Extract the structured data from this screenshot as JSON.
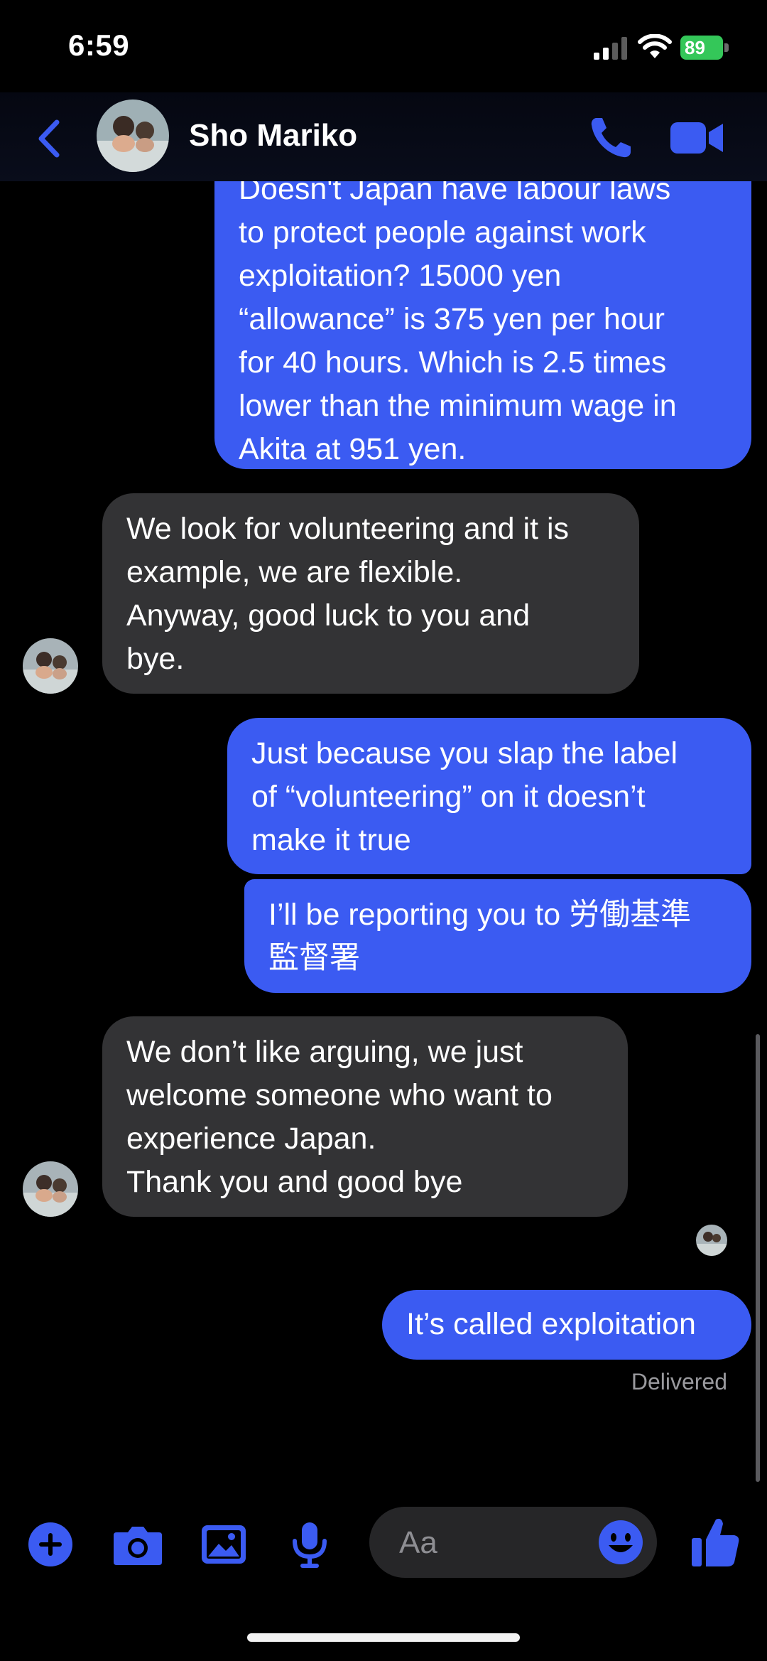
{
  "status_bar": {
    "time": "6:59",
    "battery": "89",
    "battery_color": "#34c759"
  },
  "header": {
    "contact_name": "Sho Mariko",
    "icons": [
      "back-chevron-icon",
      "phone-icon",
      "video-camera-icon"
    ],
    "accent_color": "#3b5bf2"
  },
  "messages": [
    {
      "direction": "outgoing",
      "text": "Doesn't Japan have labour laws\nto protect people against work\nexploitation? 15000 yen\n“allowance” is 375 yen per hour\nfor 40 hours. Which is 2.5 times\nlower than the minimum wage in\nAkita at 951 yen."
    },
    {
      "direction": "incoming",
      "text": "We look for volunteering and it is\nexample, we are flexible.\nAnyway, good luck to you and\nbye."
    },
    {
      "direction": "outgoing",
      "text": "Just because you slap the label\nof “volunteering” on it doesn’t\nmake it true"
    },
    {
      "direction": "outgoing",
      "text": "I’ll be reporting you to 労働基準\n監督署"
    },
    {
      "direction": "incoming",
      "text": "We don’t like arguing, we just\nwelcome someone who want to\nexperience Japan.\nThank you and good bye"
    },
    {
      "direction": "outgoing",
      "text": "It’s called exploitation"
    }
  ],
  "delivery_status": "Delivered",
  "composer": {
    "placeholder": "Aa",
    "icons": [
      "plus-icon",
      "camera-icon",
      "gallery-icon",
      "microphone-icon",
      "emoji-icon",
      "thumbs-up-icon"
    ]
  }
}
